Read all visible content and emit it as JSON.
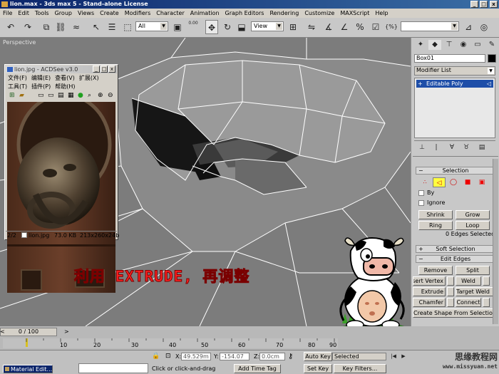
{
  "window": {
    "title": "lion.max - 3ds max 5 - Stand-alone License",
    "controls": [
      "_",
      "□",
      "x"
    ]
  },
  "menubar": [
    "File",
    "Edit",
    "Tools",
    "Group",
    "Views",
    "Create",
    "Modifiers",
    "Character",
    "Animation",
    "Graph Editors",
    "Rendering",
    "Customize",
    "MAXScript",
    "Help"
  ],
  "toolbar": {
    "selection_filter": "All",
    "reference_coord": "View",
    "spinner_value": "0.00",
    "bracket_label": "{%}"
  },
  "viewport": {
    "label": "Perspective"
  },
  "acdsee": {
    "title": "lion.jpg - ACDSee v3.0",
    "menu_row1": [
      "文件(F)",
      "编辑(E)",
      "查看(V)",
      "扩展(X)"
    ],
    "menu_row2": [
      "工具(T)",
      "插件(P)",
      "帮助(H)"
    ],
    "status": [
      "2/2",
      "lion.jpg",
      "73.0 KB",
      "213x260x24b"
    ]
  },
  "command_panel": {
    "object_name": "Box01",
    "modifier_list": "Modifier List",
    "stack_item": "Editable Poly",
    "selection_header": "Selection",
    "by_vertex": "By",
    "ignore_backfacing": "Ignore",
    "shrink": "Shrink",
    "grow": "Grow",
    "ring": "Ring",
    "loop": "Loop",
    "edges_selected": "0 Edges Selected",
    "soft_selection": "Soft Selection",
    "edit_edges": "Edit Edges",
    "remove": "Remove",
    "split": "Split",
    "insert_vertex": "Insert Vertex",
    "weld": "Weld",
    "extrude": "Extrude",
    "target_weld": "Target Weld",
    "chamfer": "Chamfer",
    "connect": "Connect",
    "create_shape": "Create Shape From Selection"
  },
  "overlay_text": "利用 EXTRUDE, 再调整",
  "timeline": {
    "slider": "0 / 100",
    "ticks": [
      "10",
      "20",
      "30",
      "40",
      "50",
      "60",
      "70",
      "80",
      "90"
    ]
  },
  "statusbar": {
    "material_editor": "Material Edit...",
    "x_label": "X:",
    "x_value": "49.529m",
    "y_label": "Y:",
    "y_value": "-154.07",
    "z_label": "Z:",
    "z_value": "0.0cm",
    "prompt": "Click or click-and-drag",
    "add_time_tag": "Add Time Tag",
    "auto_key": "Auto Key",
    "set_key": "Set Key",
    "selected": "Selected",
    "key_filters": "Key Filters..."
  },
  "watermark": {
    "line1": "思缘教程网",
    "line2": "www.missyuan.net"
  }
}
